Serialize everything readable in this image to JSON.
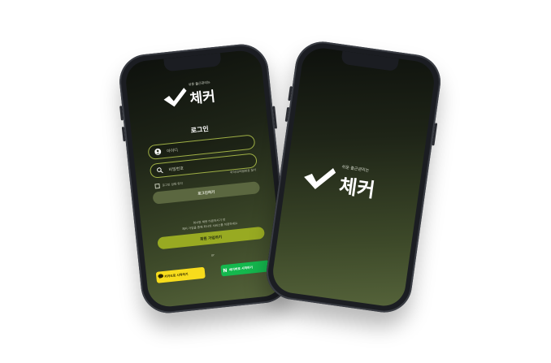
{
  "logo": {
    "tagline": "쉬운 출근관리는",
    "word": "체커"
  },
  "login_screen": {
    "title": "로그인",
    "id_placeholder": "아이디",
    "password_placeholder": "비밀번호",
    "find_account": "아이디/비밀번호 찾기",
    "remember_login": "로그인 상태 유지",
    "login_button": "로그인하기",
    "join_note_1": "회사원 채용 이용하시기 전",
    "join_note_2": "체커 가입을 통해 회사의 서비스를 이용하세요",
    "join_button": "회원 가입하기",
    "or_label": "or",
    "kakao_button": "카카오로 시작하기",
    "naver_button": "네이버로 시작하기"
  },
  "colors": {
    "accent": "#98aa22",
    "kakao": "#f7dc1c",
    "naver": "#14b84e"
  },
  "icons": [
    "user-icon",
    "search-icon",
    "check-logo-icon",
    "kakao-speech-icon",
    "naver-n-icon"
  ]
}
